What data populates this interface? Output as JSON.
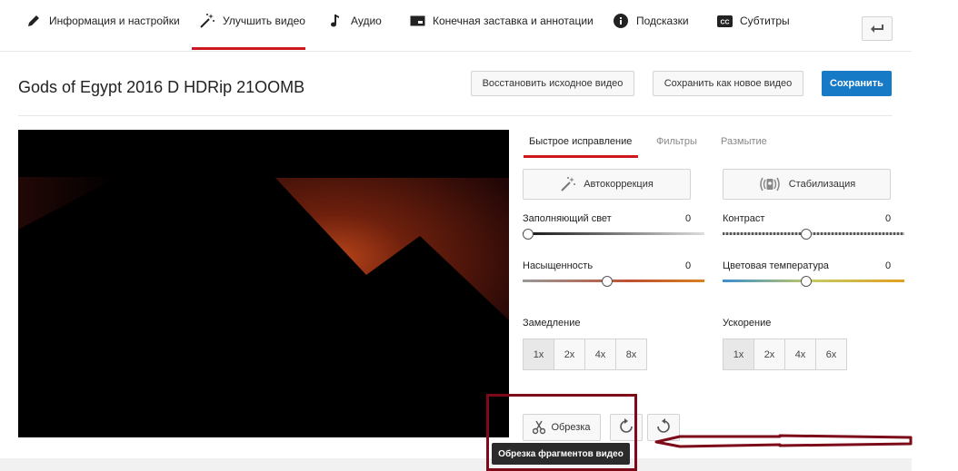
{
  "tabs": [
    {
      "label": "Информация и настройки",
      "icon": "pencil-icon"
    },
    {
      "label": "Улучшить видео",
      "icon": "magic-wand-icon",
      "active": true
    },
    {
      "label": "Аудио",
      "icon": "music-note-icon"
    },
    {
      "label": "Конечная заставка и аннотации",
      "icon": "end-screen-icon"
    },
    {
      "label": "Подсказки",
      "icon": "info-icon"
    },
    {
      "label": "Субтитры",
      "icon": "cc-icon"
    }
  ],
  "header": {
    "title": "Gods of Egypt 2016 D HDRip 21OOMB",
    "restore_label": "Восстановить исходное видео",
    "save_new_label": "Сохранить как новое видео",
    "save_label": "Сохранить"
  },
  "colors": {
    "accent": "#cc181e",
    "primary": "#167ac6",
    "annotation": "#7c0a19"
  },
  "subtabs": [
    "Быстрое исправление",
    "Фильтры",
    "Размытие"
  ],
  "actions": {
    "autocorrect": "Автокоррекция",
    "stabilize": "Стабилизация"
  },
  "sliders": {
    "fill_light": {
      "label": "Заполняющий свет",
      "value": "0"
    },
    "contrast": {
      "label": "Контраст",
      "value": "0"
    },
    "saturation": {
      "label": "Насыщенность",
      "value": "0"
    },
    "temperature": {
      "label": "Цветовая температура",
      "value": "0"
    }
  },
  "slowdown": {
    "label": "Замедление",
    "options": [
      "1x",
      "2x",
      "4x",
      "8x"
    ],
    "selected": "1x"
  },
  "speedup": {
    "label": "Ускорение",
    "options": [
      "1x",
      "2x",
      "4x",
      "6x"
    ],
    "selected": "1x"
  },
  "trim": {
    "label": "Обрезка",
    "tooltip": "Обрезка фрагментов видео"
  }
}
